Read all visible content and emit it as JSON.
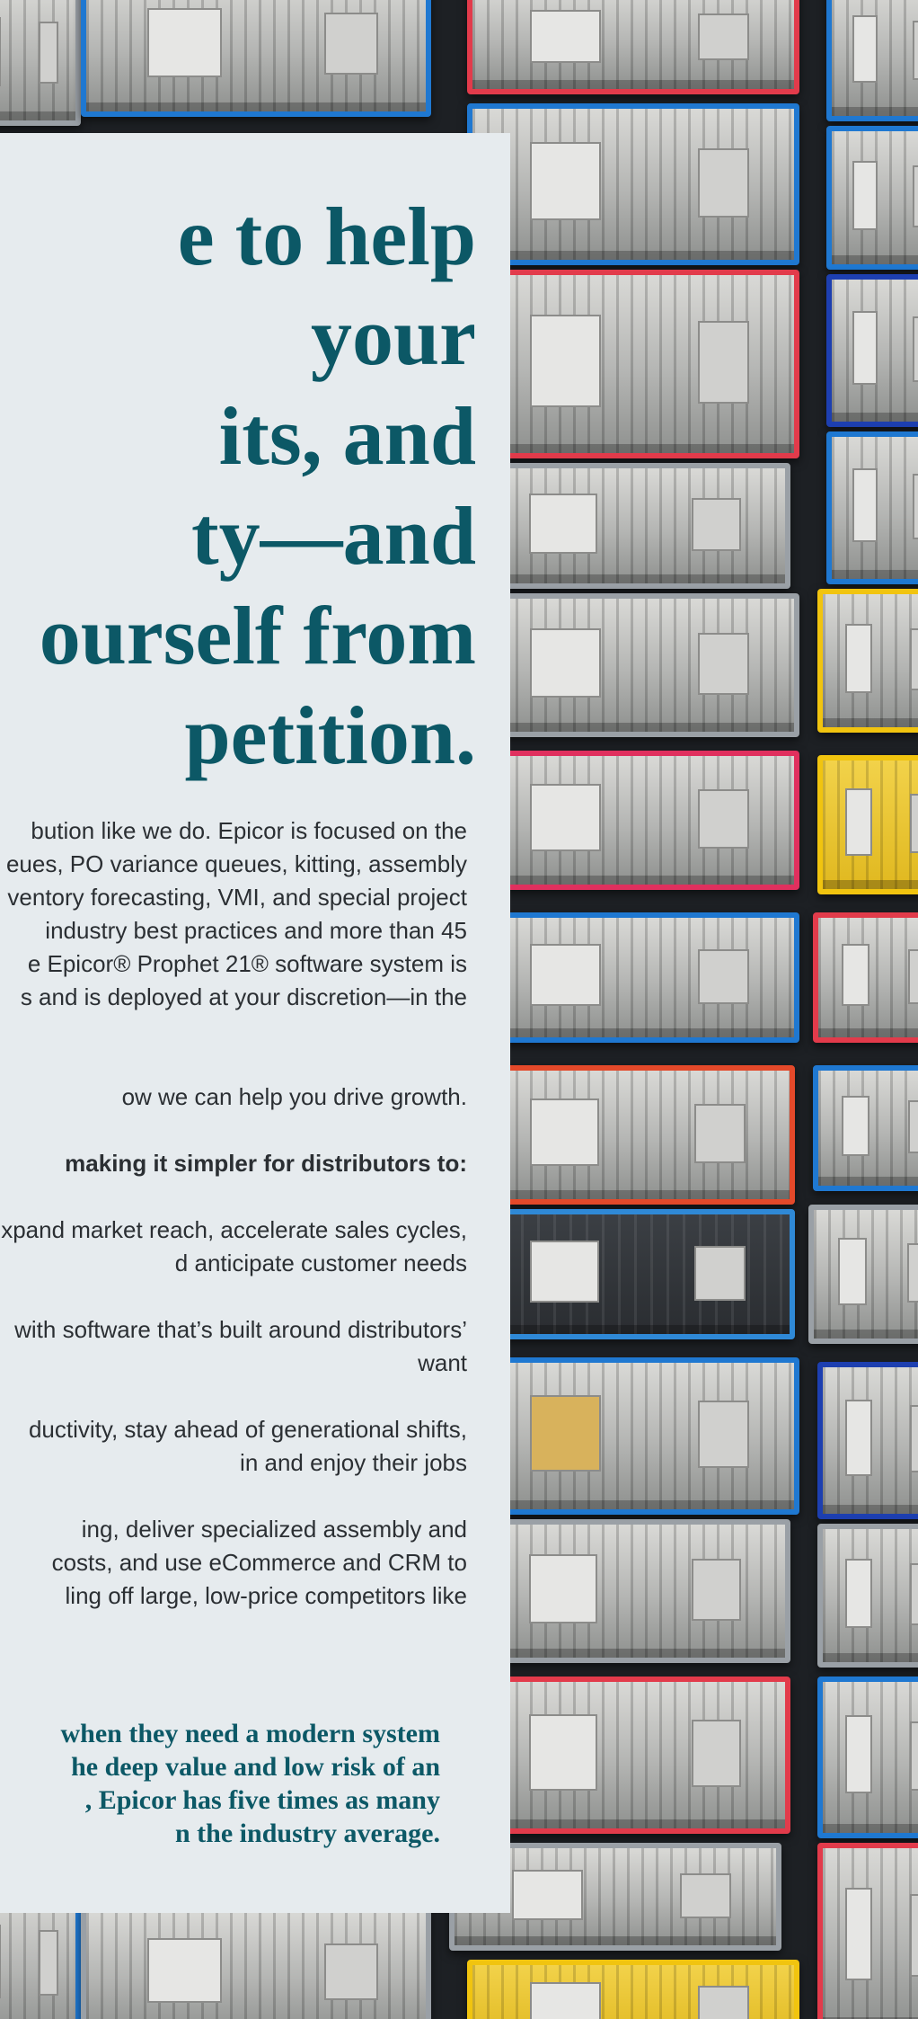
{
  "headline": {
    "lines": [
      "e to help",
      "your",
      "its, and",
      "ty—and",
      "ourself from",
      "petition."
    ]
  },
  "intro": {
    "lines": [
      "bution like we do. Epicor is focused on the",
      "eues, PO variance queues, kitting, assembly",
      "ventory forecasting, VMI, and special project",
      "industry best practices and more than 45",
      "e Epicor® Prophet 21® software system is",
      "s and is deployed at your discretion—in the"
    ]
  },
  "cta_text": "ow we can help you drive growth.",
  "lead_text": "making it simpler for distributors to:",
  "bullets": [
    {
      "lines": [
        "xpand market reach, accelerate sales cycles,",
        "d anticipate customer needs"
      ]
    },
    {
      "lines": [
        "with software that’s built around distributors’",
        "want"
      ]
    },
    {
      "lines": [
        "ductivity, stay ahead of generational shifts,",
        "in and enjoy their jobs"
      ]
    },
    {
      "lines": [
        "ing, deliver specialized assembly and",
        "costs, and use eCommerce and CRM to",
        "ling off large, low-price competitors like"
      ]
    }
  ],
  "closing": {
    "lines": [
      "when they need a modern system",
      "he deep value and low risk of an",
      ", Epicor has five times as many",
      "n the industry average."
    ]
  },
  "colors": {
    "panel_bg": "#e6ebee",
    "headline": "#0c5866",
    "body_text": "#2b2f33"
  }
}
